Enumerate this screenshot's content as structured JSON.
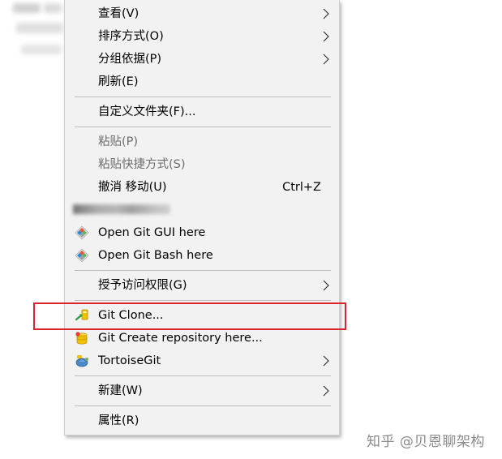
{
  "menu": {
    "items": [
      {
        "label": "查看(V)",
        "submenu": true
      },
      {
        "label": "排序方式(O)",
        "submenu": true
      },
      {
        "label": "分组依据(P)",
        "submenu": true
      },
      {
        "label": "刷新(E)"
      },
      {
        "label": "自定义文件夹(F)..."
      },
      {
        "label": "粘贴(P)",
        "disabled": true
      },
      {
        "label": "粘贴快捷方式(S)",
        "disabled": true
      },
      {
        "label": "撤消 移动(U)",
        "shortcut": "Ctrl+Z"
      },
      {
        "label": "Open Git GUI here",
        "icon": "git-icon"
      },
      {
        "label": "Open Git Bash here",
        "icon": "git-icon"
      },
      {
        "label": "授予访问权限(G)",
        "submenu": true
      },
      {
        "label": "Git Clone...",
        "icon": "tortoisegit-clone-icon"
      },
      {
        "label": "Git Create repository here...",
        "icon": "tortoisegit-create-repo-icon"
      },
      {
        "label": "TortoiseGit",
        "icon": "tortoisegit-icon",
        "submenu": true
      },
      {
        "label": "新建(W)",
        "submenu": true
      },
      {
        "label": "属性(R)"
      }
    ]
  },
  "watermark": "知乎 @贝恩聊架构",
  "colors": {
    "menu_bg": "#f2f2f2",
    "highlight_border": "#d9242b",
    "separator": "#bdbdbd",
    "disabled_text": "#6d6d6d"
  }
}
